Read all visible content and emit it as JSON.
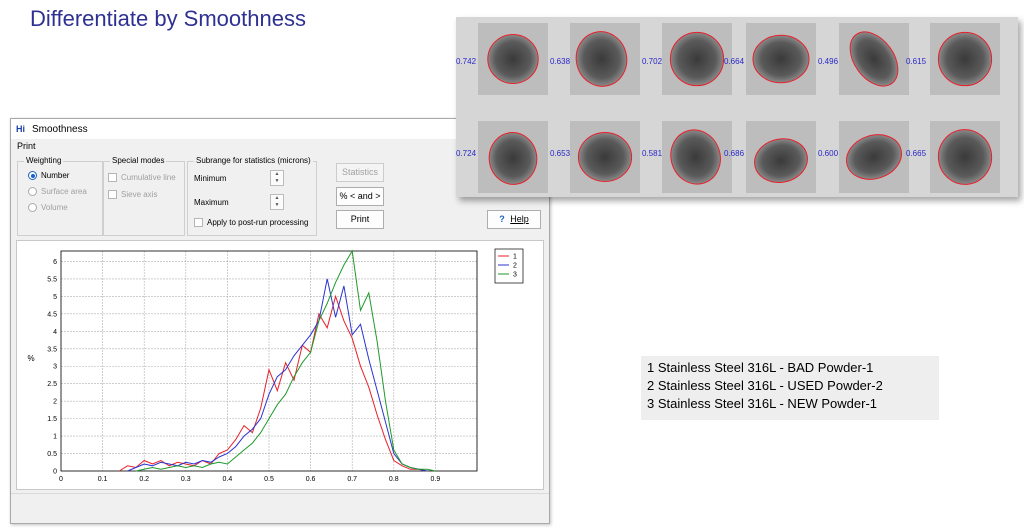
{
  "slide": {
    "title": "Differentiate by Smoothness"
  },
  "window": {
    "title": "Smoothness",
    "app_icon": "Hi",
    "menu": [
      "Print"
    ],
    "weighting": {
      "label": "Weighting",
      "options": [
        "Number",
        "Surface area",
        "Volume"
      ],
      "selected": "Number"
    },
    "special_modes": {
      "label": "Special modes",
      "options": [
        "Cumulative line",
        "Sieve axis"
      ]
    },
    "subrange": {
      "label": "Subrange for statistics (microns)",
      "minimum_label": "Minimum",
      "maximum_label": "Maximum",
      "apply_label": "Apply to post-run processing"
    },
    "buttons": {
      "statistics": "Statistics",
      "range": "% < and >",
      "print": "Print",
      "help": "Help"
    }
  },
  "particles": {
    "row1": [
      "0.742",
      "0.638",
      "0.702",
      "0.664",
      "0.496",
      "0.615"
    ],
    "row2": [
      "0.724",
      "0.653",
      "0.581",
      "0.686",
      "0.600",
      "0.665"
    ]
  },
  "legend_box": {
    "lines": [
      "1  Stainless Steel 316L - BAD Powder-1",
      "2  Stainless Steel 316L - USED Powder-2",
      "3  Stainless Steel 316L - NEW Powder-1"
    ]
  },
  "colors": {
    "series1": "#e8202a",
    "series2": "#2b34d1",
    "series3": "#1f9a2a",
    "title": "#2e3192",
    "particle_outline": "#e8202a"
  },
  "chart_data": {
    "type": "line",
    "ylabel": "%",
    "xlabel": "",
    "xlim": [
      0,
      1.0
    ],
    "ylim": [
      0,
      6.3
    ],
    "xticks": [
      "0",
      "0.1",
      "0.2",
      "0.3",
      "0.4",
      "0.5",
      "0.6",
      "0.7",
      "0.8",
      "0.9"
    ],
    "xtick_values": [
      0,
      0.1,
      0.2,
      0.3,
      0.4,
      0.5,
      0.6,
      0.7,
      0.8,
      0.9
    ],
    "yticks": [
      "0",
      "0.5",
      "1",
      "1.5",
      "2",
      "2.5",
      "3",
      "3.5",
      "4",
      "4.5",
      "5",
      "5.5",
      "6"
    ],
    "ytick_values": [
      0,
      0.5,
      1,
      1.5,
      2,
      2.5,
      3,
      3.5,
      4,
      4.5,
      5,
      5.5,
      6
    ],
    "grid": true,
    "legend_position": "top-right",
    "series": [
      {
        "name": "1",
        "x": [
          0.14,
          0.16,
          0.18,
          0.2,
          0.22,
          0.24,
          0.26,
          0.28,
          0.3,
          0.32,
          0.34,
          0.36,
          0.38,
          0.4,
          0.42,
          0.44,
          0.46,
          0.48,
          0.5,
          0.52,
          0.54,
          0.56,
          0.58,
          0.6,
          0.62,
          0.64,
          0.66,
          0.68,
          0.7,
          0.72,
          0.74,
          0.76,
          0.78,
          0.8,
          0.82,
          0.84,
          0.86,
          0.88
        ],
        "y": [
          0,
          0.15,
          0.1,
          0.3,
          0.2,
          0.3,
          0.15,
          0.25,
          0.2,
          0.15,
          0.3,
          0.2,
          0.5,
          0.6,
          0.9,
          1.3,
          1.1,
          1.8,
          2.9,
          2.3,
          3.1,
          2.6,
          3.6,
          3.4,
          4.5,
          4.1,
          5.0,
          4.3,
          3.8,
          3.0,
          2.4,
          1.6,
          0.9,
          0.3,
          0.15,
          0.05,
          0.05,
          0
        ]
      },
      {
        "name": "2",
        "x": [
          0.16,
          0.18,
          0.2,
          0.22,
          0.24,
          0.26,
          0.28,
          0.3,
          0.32,
          0.34,
          0.36,
          0.38,
          0.4,
          0.42,
          0.44,
          0.46,
          0.48,
          0.5,
          0.52,
          0.54,
          0.56,
          0.58,
          0.6,
          0.62,
          0.64,
          0.66,
          0.68,
          0.7,
          0.72,
          0.74,
          0.76,
          0.78,
          0.8,
          0.82,
          0.84,
          0.86,
          0.88
        ],
        "y": [
          0,
          0.1,
          0.2,
          0.15,
          0.25,
          0.2,
          0.15,
          0.25,
          0.2,
          0.3,
          0.25,
          0.4,
          0.5,
          0.7,
          1.0,
          1.2,
          1.5,
          2.2,
          2.7,
          2.9,
          3.3,
          3.6,
          3.9,
          4.3,
          5.5,
          4.4,
          5.3,
          3.9,
          4.2,
          3.2,
          2.3,
          1.4,
          0.5,
          0.2,
          0.1,
          0.05,
          0
        ]
      },
      {
        "name": "3",
        "x": [
          0.18,
          0.2,
          0.22,
          0.24,
          0.26,
          0.28,
          0.3,
          0.32,
          0.34,
          0.36,
          0.38,
          0.4,
          0.42,
          0.44,
          0.46,
          0.48,
          0.5,
          0.52,
          0.54,
          0.56,
          0.58,
          0.6,
          0.62,
          0.64,
          0.66,
          0.68,
          0.7,
          0.72,
          0.74,
          0.76,
          0.78,
          0.8,
          0.82,
          0.84,
          0.86,
          0.88,
          0.9
        ],
        "y": [
          0,
          0.05,
          0.1,
          0.05,
          0.1,
          0.15,
          0.1,
          0.15,
          0.1,
          0.2,
          0.25,
          0.2,
          0.4,
          0.6,
          0.8,
          1.1,
          1.5,
          1.9,
          2.2,
          2.7,
          3.1,
          3.4,
          4.3,
          4.8,
          5.4,
          5.9,
          6.3,
          4.6,
          5.1,
          3.7,
          2.0,
          0.6,
          0.2,
          0.1,
          0.05,
          0.05,
          0
        ]
      }
    ]
  }
}
